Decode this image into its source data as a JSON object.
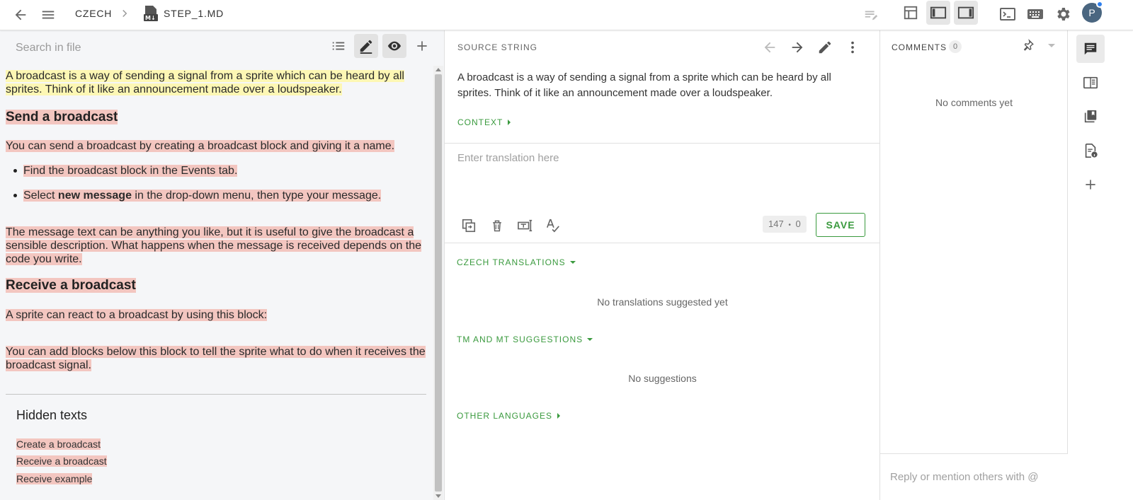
{
  "topbar": {
    "breadcrumb_project": "CZECH",
    "breadcrumb_file": "STEP_1.MD",
    "avatar_initial": "P"
  },
  "editor": {
    "search_placeholder": "Search in file",
    "intro": "A broadcast is a way of sending a signal from a sprite which can be heard by all sprites. Think of it like an announcement made over a loudspeaker.",
    "heading_send": "Send a broadcast",
    "para_send": "You can send a broadcast by creating a broadcast block and giving it a name.",
    "bullet_1": "Find the broadcast block in the Events tab.",
    "bullet_2_pre": "Select ",
    "bullet_2_bold": "new message",
    "bullet_2_post": " in the drop-down menu, then type your message.",
    "para_message": "The message text can be anything you like, but it is useful to give the broadcast a sensible description. What happens when the message is received depends on the code you write.",
    "heading_receive": "Receive a broadcast",
    "para_react": "A sprite can react to a broadcast by using this block:",
    "para_add": "You can add blocks below this block to tell the sprite what to do when it receives the broadcast signal.",
    "hidden_title": "Hidden texts",
    "hidden_items": [
      "Create a broadcast",
      "Receive a broadcast",
      "Receive example"
    ]
  },
  "source": {
    "label": "SOURCE STRING",
    "text": "A broadcast is a way of sending a signal from a sprite which can be heard by all sprites. Think of it like an announcement made over a loudspeaker.",
    "context_label": "CONTEXT",
    "translation_placeholder": "Enter translation here",
    "count_source": "147",
    "count_sep": "•",
    "count_translation": "0",
    "save_label": "SAVE"
  },
  "suggestions": {
    "czech_label": "CZECH TRANSLATIONS",
    "czech_empty": "No translations suggested yet",
    "tm_label": "TM AND MT SUGGESTIONS",
    "tm_empty": "No suggestions",
    "other_label": "OTHER LANGUAGES"
  },
  "comments": {
    "label": "COMMENTS",
    "count": "0",
    "empty": "No comments yet",
    "reply_placeholder": "Reply or mention others with @"
  },
  "colors": {
    "accent_green": "#3a9a3e",
    "highlight_yellow": "#fdf7b4",
    "highlight_red": "#f3c6c0"
  }
}
